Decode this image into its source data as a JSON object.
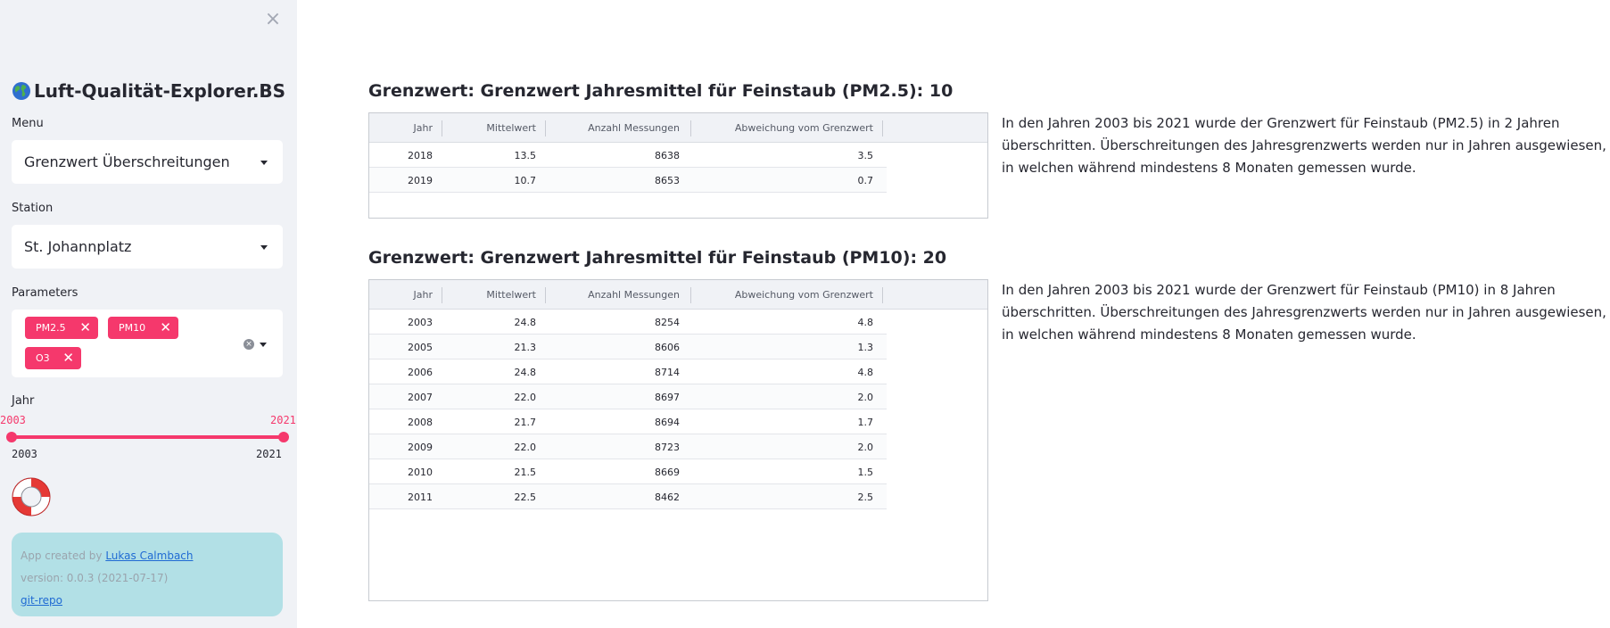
{
  "sidebar": {
    "close_icon": "×",
    "app_title": "Luft-Qualität-Explorer.BS",
    "menu_label": "Menu",
    "menu_value": "Grenzwert Überschreitungen",
    "station_label": "Station",
    "station_value": "St. Johannplatz",
    "parameters_label": "Parameters",
    "parameters": [
      "PM2.5",
      "PM10",
      "O3"
    ],
    "chip_remove": "✕",
    "clear_all": "×",
    "year_label": "Jahr",
    "year_range": {
      "from": "2003",
      "to": "2021"
    },
    "year_min": "2003",
    "year_max": "2021",
    "info": {
      "created_prefix": "App created by ",
      "author": "Lukas Calmbach",
      "version": "version: 0.0.3 (2021-07-17)",
      "repo": "git-repo"
    }
  },
  "sections": [
    {
      "title": "Grenzwert: Grenzwert Jahresmittel für Feinstaub (PM2.5): 10",
      "columns": [
        "Jahr",
        "Mittelwert",
        "Anzahl Messungen",
        "Abweichung vom Grenzwert"
      ],
      "rows": [
        [
          "2018",
          "13.5",
          "8638",
          "3.5"
        ],
        [
          "2019",
          "10.7",
          "8653",
          "0.7"
        ]
      ],
      "text": "In den Jahren 2003 bis 2021 wurde der Grenzwert für Feinstaub (PM2.5) in 2 Jahren überschritten. Überschreitungen des Jahresgrenzwerts werden nur in Jahren ausgewiesen, in welchen während mindestens 8 Monaten gemessen wurde."
    },
    {
      "title": "Grenzwert: Grenzwert Jahresmittel für Feinstaub (PM10): 20",
      "columns": [
        "Jahr",
        "Mittelwert",
        "Anzahl Messungen",
        "Abweichung vom Grenzwert"
      ],
      "rows": [
        [
          "2003",
          "24.8",
          "8254",
          "4.8"
        ],
        [
          "2005",
          "21.3",
          "8606",
          "1.3"
        ],
        [
          "2006",
          "24.8",
          "8714",
          "4.8"
        ],
        [
          "2007",
          "22.0",
          "8697",
          "2.0"
        ],
        [
          "2008",
          "21.7",
          "8694",
          "1.7"
        ],
        [
          "2009",
          "22.0",
          "8723",
          "2.0"
        ],
        [
          "2010",
          "21.5",
          "8669",
          "1.5"
        ],
        [
          "2011",
          "22.5",
          "8462",
          "2.5"
        ]
      ],
      "text": "In den Jahren 2003 bis 2021 wurde der Grenzwert für Feinstaub (PM10) in 8 Jahren überschritten. Überschreitungen des Jahresgrenzwerts werden nur in Jahren ausgewiesen, in welchen während mindestens 8 Monaten gemessen wurde."
    }
  ],
  "colors": {
    "accent": "#f5386c",
    "sidebar_bg": "#f0f2f6",
    "info_bg": "#b2e0e6"
  }
}
